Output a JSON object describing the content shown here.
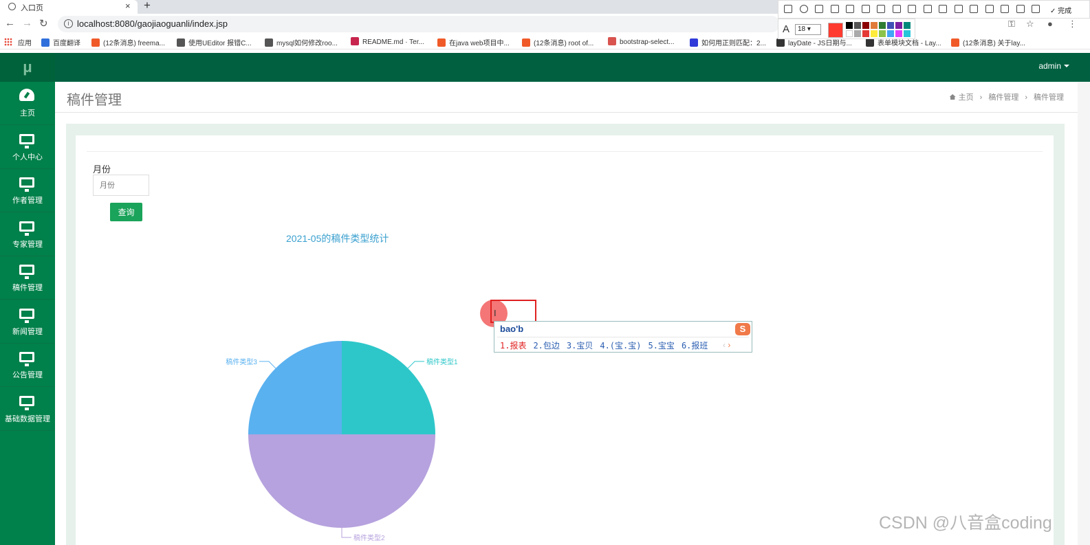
{
  "browser": {
    "tab_title": "入口页",
    "url": "localhost:8080/gaojiaoguanli/index.jsp",
    "bookmarks": [
      {
        "label": "应用",
        "color": "#e74c3c"
      },
      {
        "label": "百度翻译",
        "color": "#2f6fdb"
      },
      {
        "label": "(12条消息) freema...",
        "color": "#f05a28"
      },
      {
        "label": "使用UEditor 报错C...",
        "color": "#555555"
      },
      {
        "label": "mysql如何修改roo...",
        "color": "#555555"
      },
      {
        "label": "README.md · Ter...",
        "color": "#c7254e"
      },
      {
        "label": "在java web项目中...",
        "color": "#f05a28"
      },
      {
        "label": "(12条消息) root of...",
        "color": "#f05a28"
      },
      {
        "label": "bootstrap-select...",
        "color": "#d9534f"
      },
      {
        "label": "如何用正则匹配：2...",
        "color": "#2f3ad8"
      },
      {
        "label": "layDate - JS日期与...",
        "color": "#333333"
      },
      {
        "label": "表单模块文档 - Lay...",
        "color": "#333333"
      },
      {
        "label": "(12条消息) 关于lay...",
        "color": "#f05a28"
      }
    ]
  },
  "screenshot_tool": {
    "done_label": "完成",
    "font_size": "18",
    "current_color": "#ff3b30",
    "palette": [
      "#000000",
      "#555555",
      "#8b0000",
      "#e07b39",
      "#2e7d32",
      "#3f51b5",
      "#7b1fa2",
      "#00897b",
      "#ffffff",
      "#aaaaaa",
      "#e53935",
      "#ffeb3b",
      "#8bc34a",
      "#42a5f5",
      "#e040fb",
      "#26c6da"
    ]
  },
  "app": {
    "logo": "μ",
    "user": "admin",
    "sidebar": [
      {
        "label": "主页",
        "icon": "dashboard-icon"
      },
      {
        "label": "个人中心",
        "icon": "monitor-icon"
      },
      {
        "label": "作者管理",
        "icon": "monitor-icon"
      },
      {
        "label": "专家管理",
        "icon": "monitor-icon"
      },
      {
        "label": "稿件管理",
        "icon": "monitor-icon"
      },
      {
        "label": "新闻管理",
        "icon": "monitor-icon"
      },
      {
        "label": "公告管理",
        "icon": "monitor-icon"
      },
      {
        "label": "基础数据管理",
        "icon": "monitor-icon"
      }
    ],
    "page_title": "稿件管理",
    "breadcrumb": [
      "主页",
      "稿件管理",
      "稿件管理"
    ],
    "form": {
      "month_label": "月份",
      "month_placeholder": "月份",
      "query_button": "查询"
    }
  },
  "chart_data": {
    "type": "pie",
    "title": "2021-05的稿件类型统计",
    "slices": [
      {
        "name": "稿件类型1",
        "value": 1,
        "color": "#2ec7c9"
      },
      {
        "name": "稿件类型2",
        "value": 2,
        "color": "#b6a2de"
      },
      {
        "name": "稿件类型3",
        "value": 1,
        "color": "#5ab1ef"
      }
    ]
  },
  "ime": {
    "pinyin": "bao'b",
    "candidates": [
      "1.报表",
      "2.包边",
      "3.宝贝",
      "4.(宝.宝)",
      "5.宝宝",
      "6.报班"
    ],
    "logo": "S"
  },
  "watermark": "CSDN @八音盒coding"
}
